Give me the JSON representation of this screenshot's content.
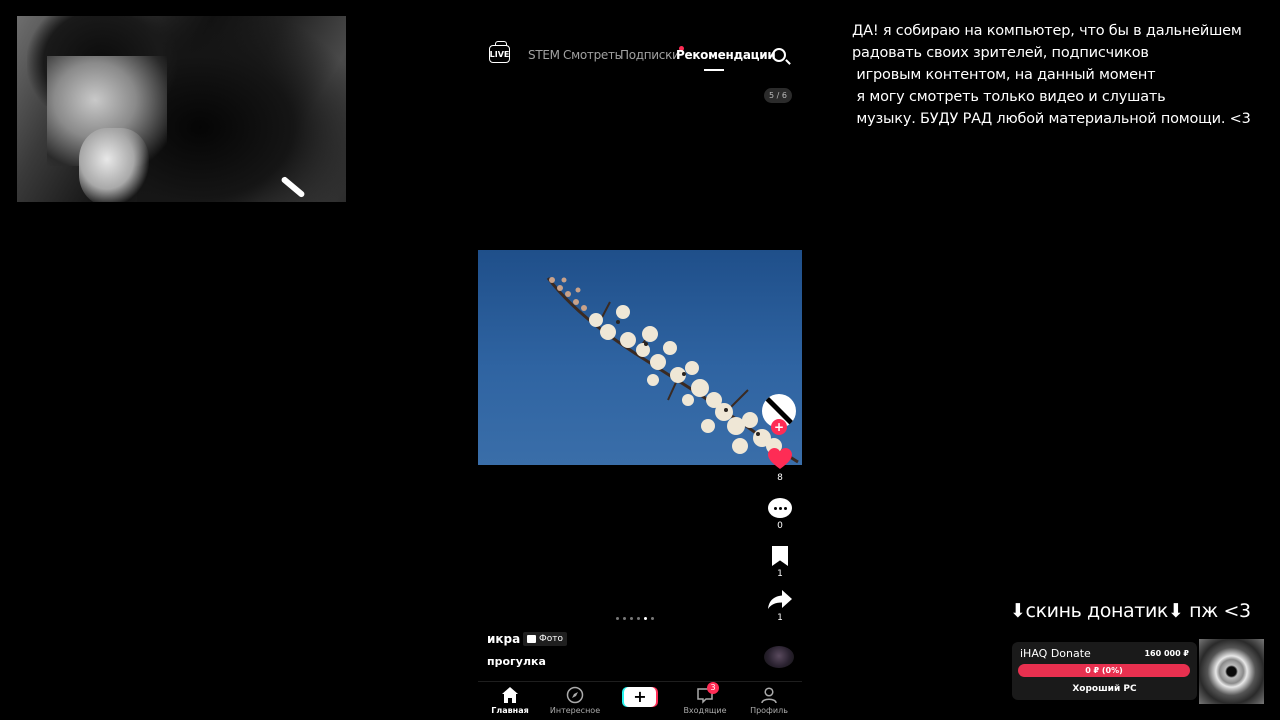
{
  "webcam": {
    "alt": "webcam"
  },
  "app": {
    "nav": {
      "live_label": "LIVE",
      "tabs": [
        {
          "label": "STEM"
        },
        {
          "label": "Смотреть"
        },
        {
          "label": "Подписки",
          "has_dot": true
        },
        {
          "label": "Рекомендации",
          "active": true
        }
      ]
    },
    "counter": "5 / 6",
    "post": {
      "author": "икра",
      "badge": "Фото",
      "caption": "прогулка",
      "likes": "8",
      "comments": "0",
      "saves": "1",
      "shares": "1",
      "slides_total": 6,
      "slide_active": 5
    },
    "bottom_nav": [
      {
        "label": "Главная",
        "icon": "home-icon",
        "active": true
      },
      {
        "label": "Интересное",
        "icon": "compass-icon"
      },
      {
        "label": "",
        "icon": "plus-icon"
      },
      {
        "label": "Входящие",
        "icon": "inbox-icon",
        "badge": "3"
      },
      {
        "label": "Профиль",
        "icon": "profile-icon"
      }
    ],
    "colors": {
      "accent": "#fe2c55",
      "cyan": "#25f4ee"
    }
  },
  "overlay": {
    "message": "ДА! я собираю на компьютер, что бы в дальнейшем\nрадовать своих зрителей, подписчиков\n игровым контентом, на данный момент\n я могу смотреть только видео и слушать\n музыку. БУДУ РАД любой материальной помощи. <3",
    "donate_cta": "⬇скинь донатик⬇ пж <3",
    "donation": {
      "title": "iHAQ Donate",
      "goal": "160 000 ₽",
      "progress_text": "0 ₽ (0%)",
      "progress_fraction": 0,
      "subtitle": "Хороший PC"
    }
  }
}
